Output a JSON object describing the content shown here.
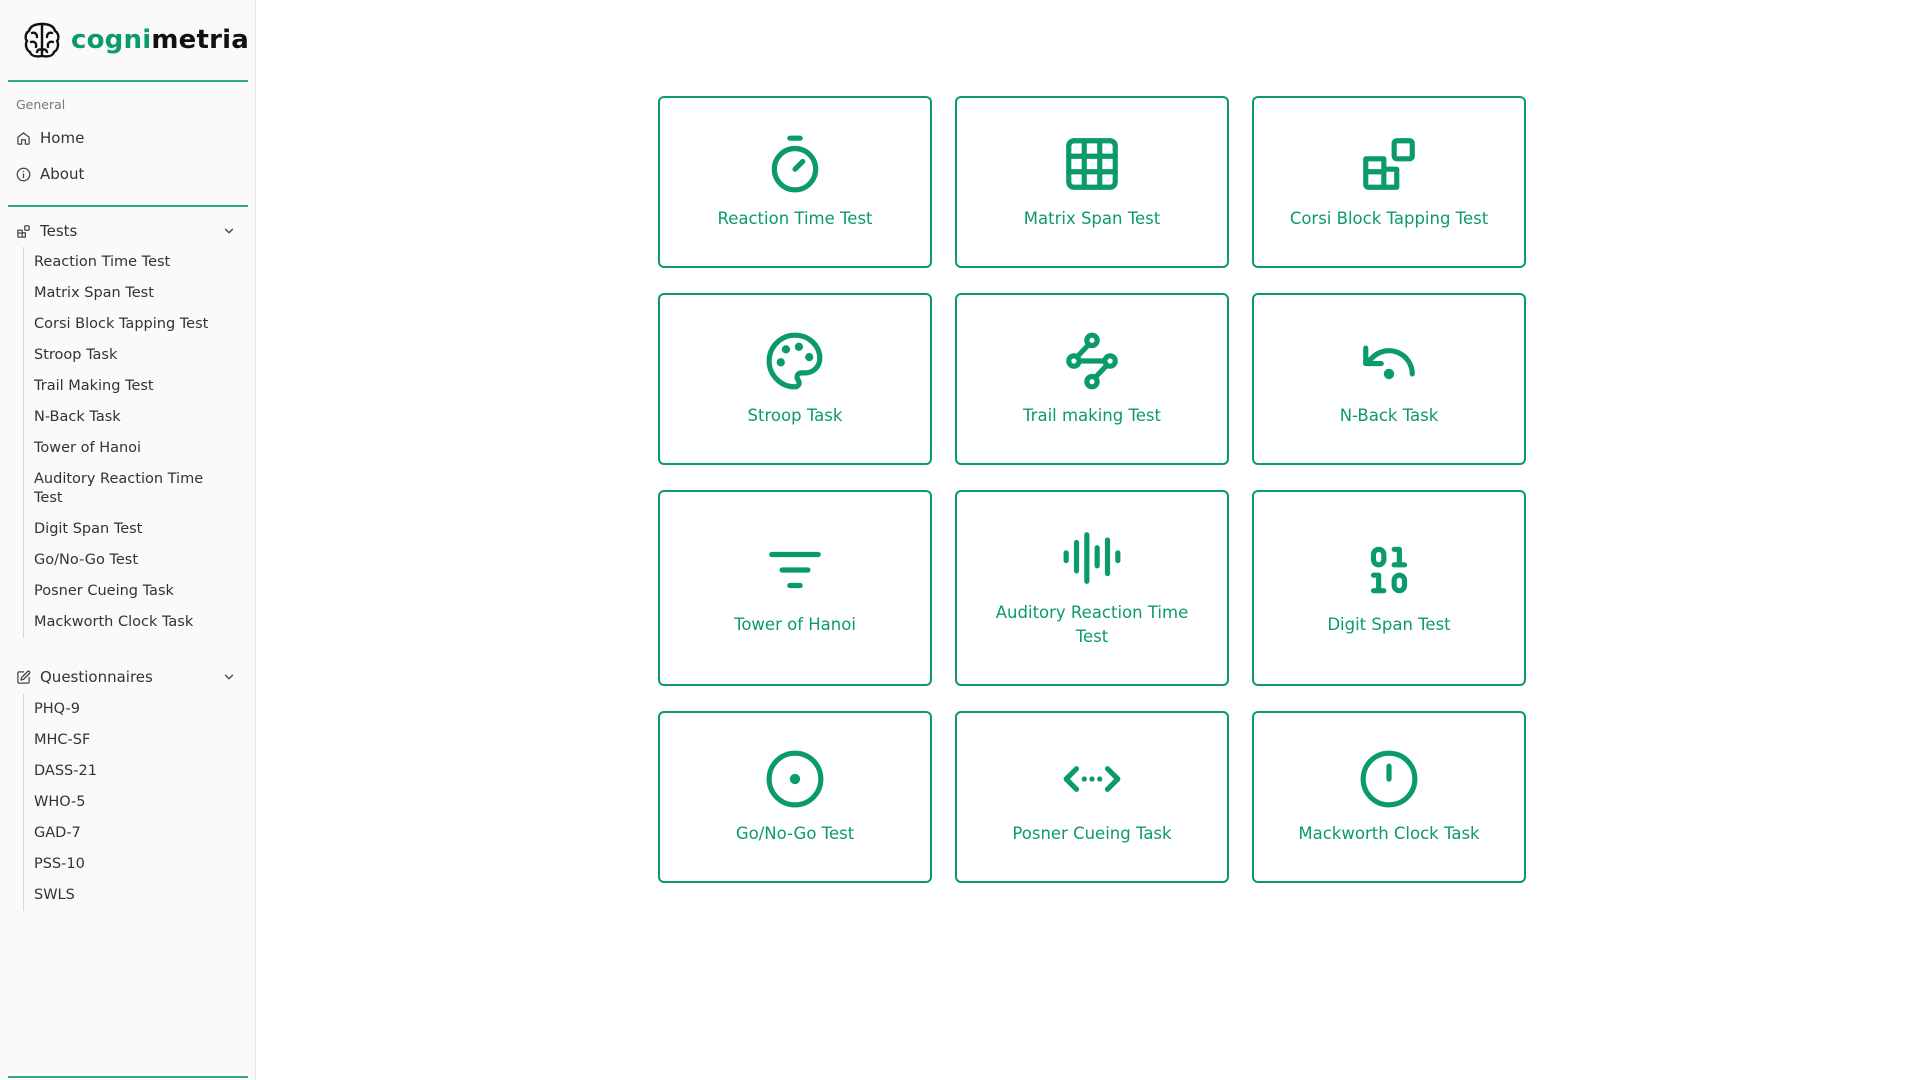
{
  "brand": {
    "name_part1": "cogni",
    "name_part2": "metria",
    "accent_color": "#0b9a6d"
  },
  "sidebar": {
    "general_label": "General",
    "general_items": [
      {
        "label": "Home",
        "icon": "home-icon"
      },
      {
        "label": "About",
        "icon": "info-icon"
      }
    ],
    "tests": {
      "label": "Tests",
      "icon": "blocks-icon",
      "items": [
        "Reaction Time Test",
        "Matrix Span Test",
        "Corsi Block Tapping Test",
        "Stroop Task",
        "Trail Making Test",
        "N-Back Task",
        "Tower of Hanoi",
        "Auditory Reaction Time Test",
        "Digit Span Test",
        "Go/No-Go Test",
        "Posner Cueing Task",
        "Mackworth Clock Task"
      ]
    },
    "questionnaires": {
      "label": "Questionnaires",
      "icon": "edit-icon",
      "items": [
        "PHQ-9",
        "MHC-SF",
        "DASS-21",
        "WHO-5",
        "GAD-7",
        "PSS-10",
        "SWLS"
      ]
    }
  },
  "cards": [
    {
      "label": "Reaction Time Test",
      "icon": "timer-icon"
    },
    {
      "label": "Matrix Span Test",
      "icon": "grid-icon"
    },
    {
      "label": "Corsi Block Tapping Test",
      "icon": "blocks-icon"
    },
    {
      "label": "Stroop Task",
      "icon": "palette-icon"
    },
    {
      "label": "Trail making Test",
      "icon": "workflow-icon"
    },
    {
      "label": "N-Back Task",
      "icon": "undo-dot-icon"
    },
    {
      "label": "Tower of Hanoi",
      "icon": "filter-lines-icon"
    },
    {
      "label": "Auditory Reaction Time Test",
      "icon": "audio-lines-icon"
    },
    {
      "label": "Digit Span Test",
      "icon": "binary-icon"
    },
    {
      "label": "Go/No-Go Test",
      "icon": "circle-dot-icon"
    },
    {
      "label": "Posner Cueing Task",
      "icon": "move-horizontal-dashed-icon"
    },
    {
      "label": "Mackworth Clock Task",
      "icon": "circle-power-icon"
    }
  ]
}
